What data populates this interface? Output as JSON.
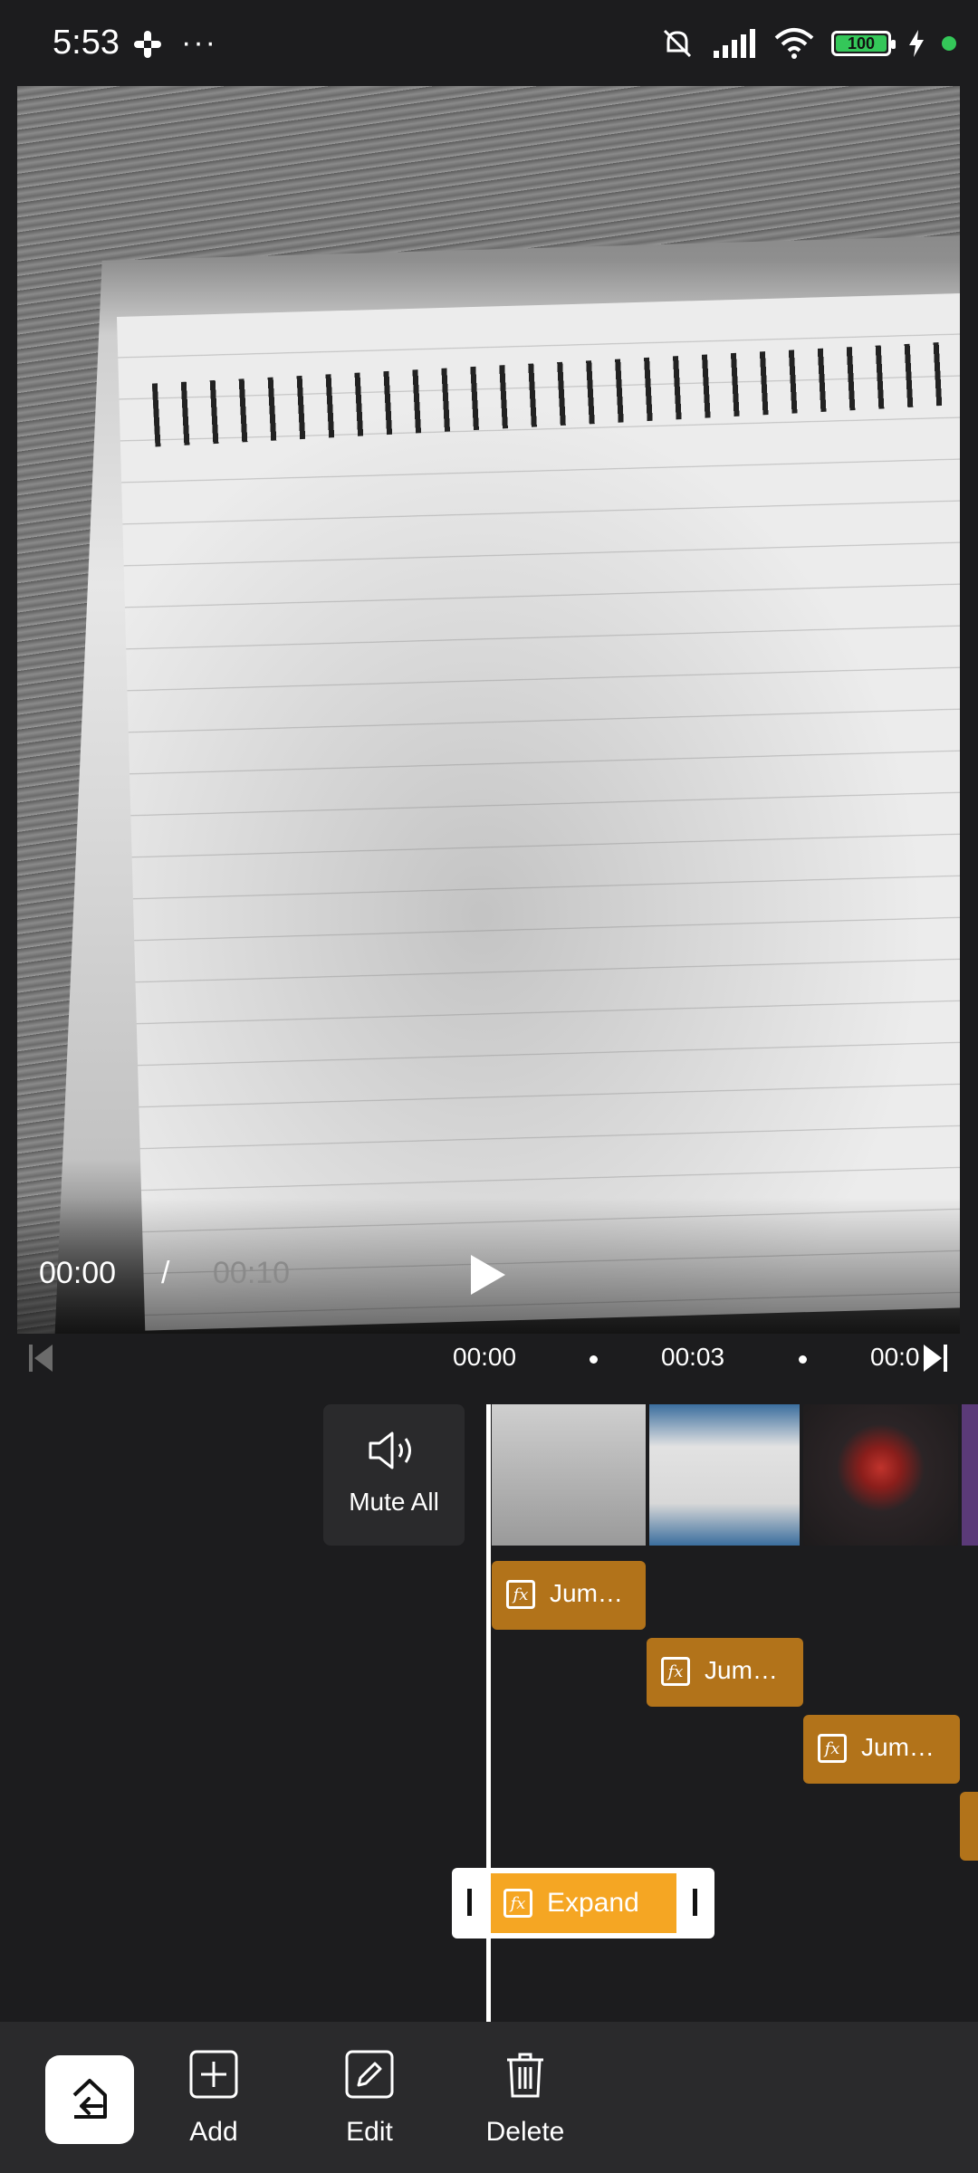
{
  "status_bar": {
    "time": "5:53",
    "more": "···",
    "battery": "100"
  },
  "player": {
    "current_time": "00:00",
    "separator": "/",
    "total_time": "00:10"
  },
  "ruler": {
    "ticks": [
      "00:00",
      "00:03",
      "00:0"
    ]
  },
  "timeline": {
    "mute_label": "Mute All",
    "effect_clips": [
      "Jum…",
      "Jum…",
      "Jum…"
    ],
    "selected_effect": "Expand"
  },
  "toolbar": {
    "add_label": "Add",
    "edit_label": "Edit",
    "delete_label": "Delete"
  },
  "colors": {
    "background": "#1c1c1e",
    "effect_clip": "#b2731a",
    "effect_selected": "#f5a623",
    "toolbar": "#2a2a2c"
  }
}
